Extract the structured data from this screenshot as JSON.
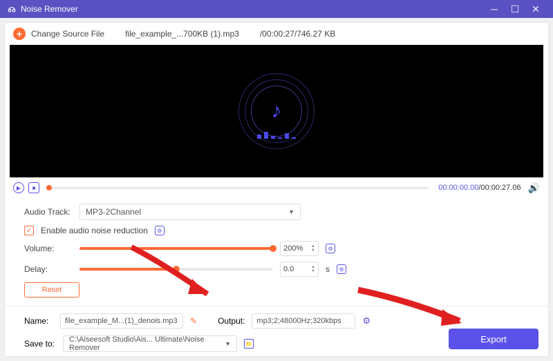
{
  "titlebar": {
    "title": "Noise Remover"
  },
  "source": {
    "change_label": "Change Source File",
    "filename": "file_example_...700KB (1).mp3",
    "info": "/00:00:27/746.27 KB"
  },
  "player": {
    "time_current": "00:00:00.00",
    "time_total": "/00:00:27.06"
  },
  "audio_track": {
    "label": "Audio Track:",
    "value": "MP3-2Channel"
  },
  "noise": {
    "label": "Enable audio noise reduction"
  },
  "volume": {
    "label": "Volume:",
    "value": "200%"
  },
  "delay": {
    "label": "Delay:",
    "value": "0.0",
    "unit": "s"
  },
  "reset": {
    "label": "Reset"
  },
  "name": {
    "label": "Name:",
    "value": "file_example_M...(1)_denois.mp3"
  },
  "output": {
    "label": "Output:",
    "value": "mp3;2;48000Hz;320kbps"
  },
  "save": {
    "label": "Save to:",
    "value": "C:\\Aiseesoft Studio\\Ais... Ultimate\\Noise Remover"
  },
  "export": {
    "label": "Export"
  }
}
